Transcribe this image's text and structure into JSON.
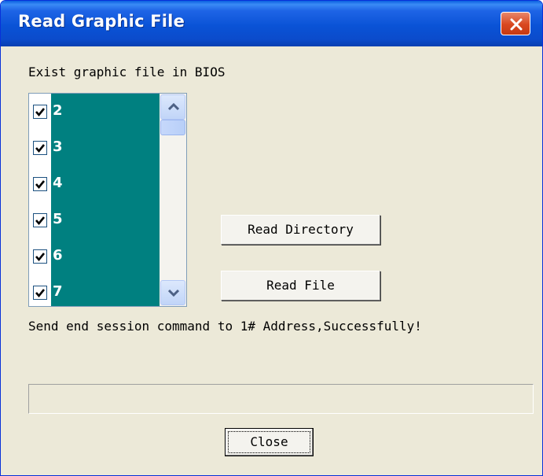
{
  "window": {
    "title": "Read Graphic File",
    "close_icon": "close-icon"
  },
  "list": {
    "label": "Exist graphic file in BIOS",
    "items": [
      {
        "label": "2",
        "checked": true
      },
      {
        "label": "3",
        "checked": true
      },
      {
        "label": "4",
        "checked": true
      },
      {
        "label": "5",
        "checked": true
      },
      {
        "label": "6",
        "checked": true
      },
      {
        "label": "7",
        "checked": true
      }
    ]
  },
  "buttons": {
    "read_directory": "Read Directory",
    "read_file": "Read File",
    "close": "Close"
  },
  "status": {
    "message": "Send end session command to 1# Address,Successfully!",
    "progress": 0
  },
  "colors": {
    "title_bar": "#0a53d6",
    "item_highlight": "#008080",
    "dialog_bg": "#ece9d8"
  }
}
